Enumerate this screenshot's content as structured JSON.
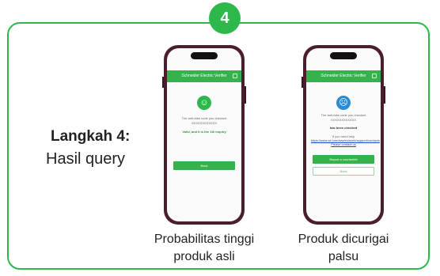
{
  "step": {
    "number": "4",
    "title": "Langkah 4:",
    "subtitle": "Hasil query"
  },
  "phones": {
    "genuine": {
      "app_title": "Schneider Electric Verifier",
      "line1": "The anti-fake code you checked",
      "code": "XXXXXXXXXXXX",
      "status": "Valid, and it is the 1th inquiry",
      "button": "Back",
      "caption_line1": "Probabilitas tinggi",
      "caption_line2": "produk asli"
    },
    "suspect": {
      "app_title": "Schneider Electric Verifier",
      "line1": "The anti-fake code you checked",
      "code": "XXXXXXXXXXXX",
      "status": "has been checked",
      "note": "If you need help",
      "link1": "https://www.se.com/ww/en/work/support/contacts",
      "link2": "Please contact us",
      "button_primary": "Report a counterfeit",
      "button_secondary": "Back",
      "caption_line1": "Produk dicurigai",
      "caption_line2": "palsu"
    }
  },
  "colors": {
    "accent": "#2db84b",
    "phone_frame": "#4a1f2c",
    "sad_face": "#2a8bd8"
  },
  "icons": {
    "happy": "smiley-face-icon",
    "sad": "sad-face-icon"
  }
}
